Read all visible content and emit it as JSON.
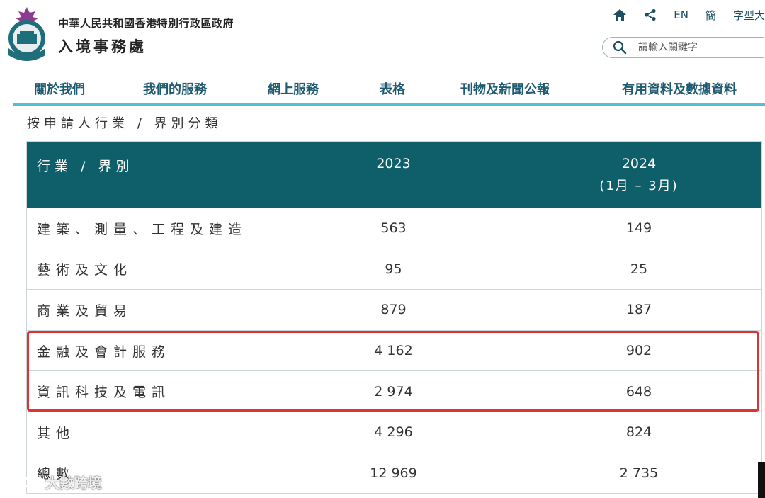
{
  "header": {
    "dept_full_name": "中華人民共和國香港特別行政區政府",
    "dept_name": "入境事務處",
    "top_links": {
      "lang_en": "EN",
      "lang_sc": "簡",
      "font_size": "字型大"
    },
    "search": {
      "placeholder": "請輸入關鍵字"
    }
  },
  "nav": {
    "items": [
      {
        "label": "關於我們"
      },
      {
        "label": "我們的服務"
      },
      {
        "label": "網上服務"
      },
      {
        "label": "表格"
      },
      {
        "label": "刊物及新聞公報"
      },
      {
        "label": "有用資料及數據資料"
      }
    ]
  },
  "page": {
    "section_title": "按申請人行業 / 界別分類"
  },
  "table": {
    "headers": {
      "col1": "行業 / 界別",
      "col2": "2023",
      "col3": "2024",
      "col3_sub": "(1月 – 3月)"
    },
    "rows": [
      {
        "sector": "建築、測量、工程及建造",
        "y2023": "563",
        "y2024": "149"
      },
      {
        "sector": "藝術及文化",
        "y2023": "95",
        "y2024": "25"
      },
      {
        "sector": "商業及貿易",
        "y2023": "879",
        "y2024": "187"
      },
      {
        "sector": "金融及會計服務",
        "y2023": "4 162",
        "y2024": "902"
      },
      {
        "sector": "資訊科技及電訊",
        "y2023": "2 974",
        "y2024": "648"
      },
      {
        "sector": "其他",
        "y2023": "4 296",
        "y2024": "824"
      },
      {
        "sector": "總數",
        "y2023": "12 969",
        "y2024": "2 735"
      }
    ]
  },
  "watermark": {
    "text": "大數跨境"
  },
  "colors": {
    "table_header_bg": "#0f5f6b",
    "nav_text": "#1e5a70",
    "nav_underline": "#4fc1d1",
    "highlight_border": "#e03232"
  }
}
